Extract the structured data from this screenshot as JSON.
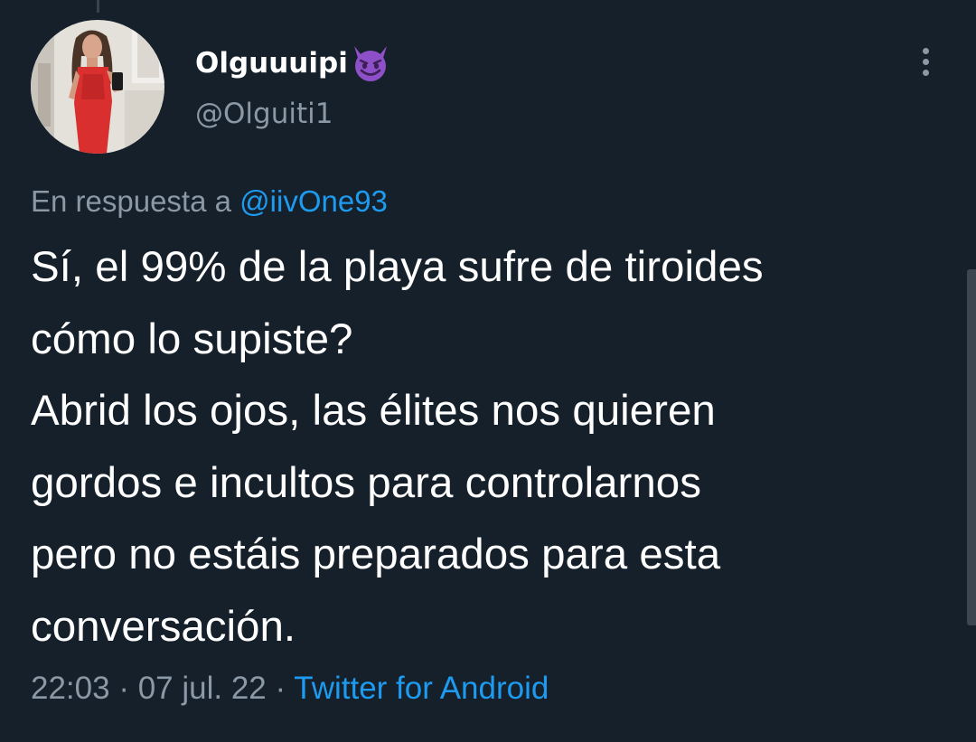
{
  "tweet": {
    "display_name": "Olguuuipi",
    "name_emoji": "smiling-face-with-horns",
    "handle": "@Olguiti1",
    "reply_prefix": "En respuesta a",
    "reply_mention": "@iivOne93",
    "text": "Sí, el 99% de la playa sufre de tiroides\ncómo lo supiste?\nAbrid los ojos, las élites nos quieren\ngordos e incultos para controlarnos\npero no estáis preparados para esta\nconversación.",
    "time": "22:03",
    "separator": "·",
    "date": "07 jul. 22",
    "source": "Twitter for Android"
  },
  "icons": {
    "more": "more-vertical-icon",
    "avatar": "profile-photo"
  },
  "colors": {
    "background": "#15202b",
    "primary_text": "#ffffff",
    "secondary_text": "#8b98a5",
    "link": "#1d9bf0",
    "emoji_purple": "#8e50c8"
  }
}
